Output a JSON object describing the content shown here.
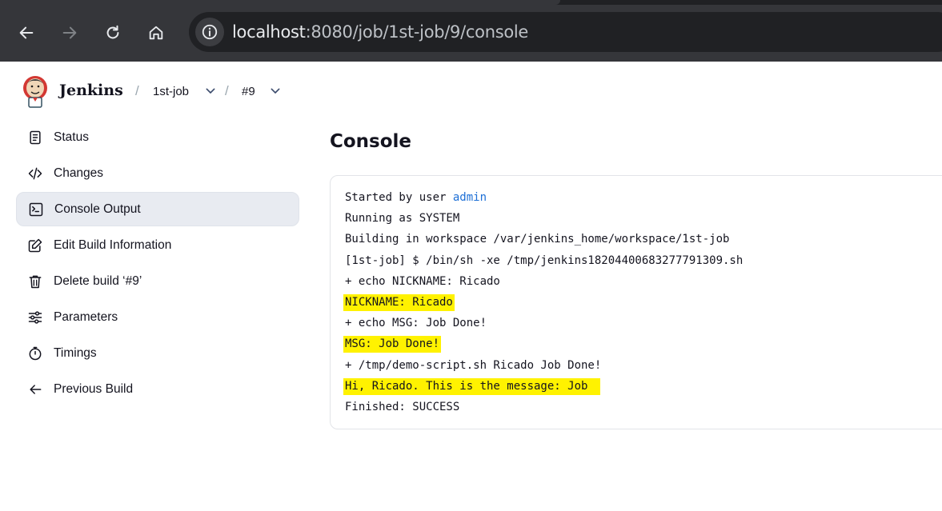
{
  "browser": {
    "url_host": "localhost",
    "url_rest": ":8080/job/1st-job/9/console"
  },
  "header": {
    "brand": "Jenkins",
    "breadcrumbs": [
      "1st-job",
      "#9"
    ]
  },
  "sidebar": {
    "items": [
      {
        "label": "Status",
        "icon": "document-icon"
      },
      {
        "label": "Changes",
        "icon": "code-icon"
      },
      {
        "label": "Console Output",
        "icon": "terminal-icon",
        "active": true
      },
      {
        "label": "Edit Build Information",
        "icon": "edit-icon"
      },
      {
        "label": "Delete build ‘#9’",
        "icon": "trash-icon"
      },
      {
        "label": "Parameters",
        "icon": "sliders-icon"
      },
      {
        "label": "Timings",
        "icon": "stopwatch-icon"
      },
      {
        "label": "Previous Build",
        "icon": "arrow-left-icon"
      }
    ]
  },
  "main": {
    "title": "Console",
    "console": {
      "started_prefix": "Started by user ",
      "started_user": "admin",
      "lines": [
        "Running as SYSTEM",
        "Building in workspace /var/jenkins_home/workspace/1st-job",
        "[1st-job] $ /bin/sh -xe /tmp/jenkins18204400683277791309.sh",
        "+ echo NICKNAME: Ricado",
        "NICKNAME: Ricado",
        "+ echo MSG: Job Done!",
        "MSG: Job Done!",
        "+ /tmp/demo-script.sh Ricado Job Done!",
        "Hi, Ricado. This is the message: Job",
        "Finished: SUCCESS"
      ],
      "highlight_color": "#fff200"
    }
  }
}
